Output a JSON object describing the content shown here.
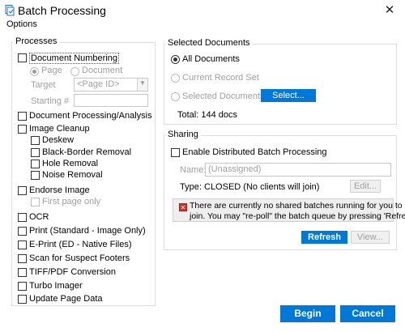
{
  "window": {
    "title": "Batch Processing",
    "close_glyph": "✕"
  },
  "menu": {
    "options_label": "Options"
  },
  "processes": {
    "group_label": "Processes",
    "document_numbering": "Document Numbering",
    "radio_page": "Page",
    "radio_document": "Document",
    "target_label": "Target",
    "target_value": "<Page ID>",
    "starting_label": "Starting #",
    "starting_value": "",
    "doc_processing": "Document Processing/Analysis",
    "image_cleanup": "Image Cleanup",
    "deskew": "Deskew",
    "black_border": "Black-Border Removal",
    "hole_removal": "Hole Removal",
    "noise_removal": "Noise Removal",
    "endorse_image": "Endorse Image",
    "first_page_only": "First page only",
    "ocr": "OCR",
    "print": "Print (Standard - Image Only)",
    "eprint": "E-Print (ED - Native Files)",
    "scan_footers": "Scan for Suspect Footers",
    "tiff_pdf": "TIFF/PDF Conversion",
    "turbo_imager": "Turbo Imager",
    "update_page_data": "Update Page Data"
  },
  "selected_documents": {
    "group_label": "Selected Documents",
    "all_documents": "All Documents",
    "current_record_set": "Current Record Set",
    "selected_documents": "Selected Documents",
    "select_button": "Select...",
    "total_text": "Total:  144 docs"
  },
  "sharing": {
    "group_label": "Sharing",
    "enable_distributed": "Enable Distributed Batch Processing",
    "name_label": "Name:",
    "name_value": "(Unassigned)",
    "type_label": "Type:",
    "type_value": "CLOSED (No clients will join)",
    "edit_button": "Edit...",
    "warning_line1": "There are currently no shared batches running for you to",
    "warning_line2": "join.  You may \"re-poll\" the batch queue by pressing 'Refresh'",
    "refresh_button": "Refresh",
    "view_button": "View..."
  },
  "footer": {
    "begin_button": "Begin",
    "cancel_button": "Cancel"
  },
  "colors": {
    "accent": "#0078d7",
    "error": "#d9302c"
  }
}
